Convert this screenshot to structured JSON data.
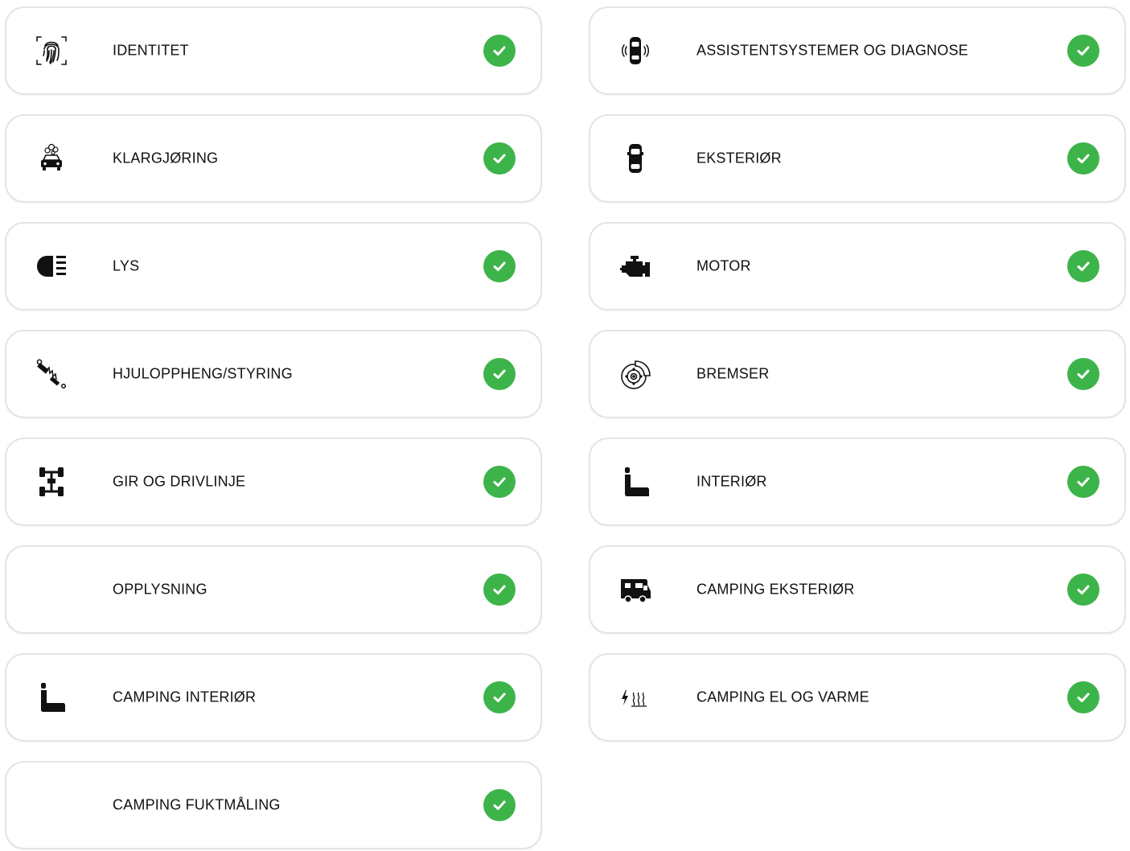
{
  "accent_color": "#3db449",
  "status_icon": "check-circle-icon",
  "categories": [
    {
      "label": "IDENTITET",
      "icon": "fingerprint-icon",
      "status": "complete"
    },
    {
      "label": "ASSISTENTSYSTEMER OG DIAGNOSE",
      "icon": "car-sensors-icon",
      "status": "complete"
    },
    {
      "label": "KLARGJØRING",
      "icon": "car-wash-icon",
      "status": "complete"
    },
    {
      "label": "EKSTERIØR",
      "icon": "car-top-icon",
      "status": "complete"
    },
    {
      "label": "LYS",
      "icon": "headlight-icon",
      "status": "complete"
    },
    {
      "label": "MOTOR",
      "icon": "engine-icon",
      "status": "complete"
    },
    {
      "label": "HJULOPPHENG/STYRING",
      "icon": "shock-absorber-icon",
      "status": "complete"
    },
    {
      "label": "BREMSER",
      "icon": "brake-disc-icon",
      "status": "complete"
    },
    {
      "label": "GIR OG DRIVLINJE",
      "icon": "drivetrain-icon",
      "status": "complete"
    },
    {
      "label": "INTERIØR",
      "icon": "seat-icon",
      "status": "complete"
    },
    {
      "label": "OPPLYSNING",
      "icon": "",
      "status": "complete"
    },
    {
      "label": "CAMPING EKSTERIØR",
      "icon": "camper-van-icon",
      "status": "complete"
    },
    {
      "label": "CAMPING INTERIØR",
      "icon": "seat-icon",
      "status": "complete"
    },
    {
      "label": "CAMPING EL OG VARME",
      "icon": "electric-heat-icon",
      "status": "complete"
    },
    {
      "label": "CAMPING FUKTMÅLING",
      "icon": "",
      "status": "complete"
    }
  ]
}
